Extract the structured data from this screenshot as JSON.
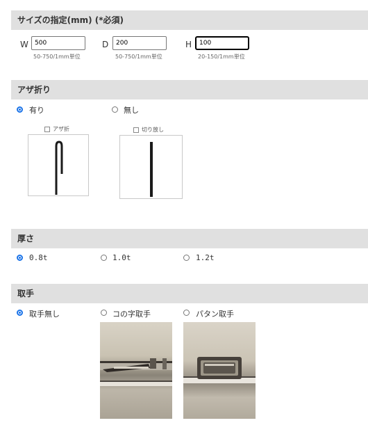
{
  "size_section": {
    "title": "サイズの指定(mm) (*必須)",
    "width": {
      "label": "W",
      "value": "500",
      "hint": "50-750/1mm単位"
    },
    "depth": {
      "label": "D",
      "value": "200",
      "hint": "50-750/1mm単位"
    },
    "height": {
      "label": "H",
      "value": "100",
      "hint": "20-150/1mm単位"
    }
  },
  "hem_section": {
    "title": "アザ折り",
    "options": [
      {
        "label": "有り",
        "checked": true
      },
      {
        "label": "無し",
        "checked": false
      }
    ],
    "diagrams": [
      {
        "caption": "アザ折"
      },
      {
        "caption": "切り放し"
      }
    ]
  },
  "thickness_section": {
    "title": "厚さ",
    "options": [
      {
        "label": "0.8t",
        "checked": true
      },
      {
        "label": "1.0t",
        "checked": false
      },
      {
        "label": "1.2t",
        "checked": false
      }
    ]
  },
  "handle_section": {
    "title": "取手",
    "options": [
      {
        "label": "取手無し",
        "checked": true
      },
      {
        "label": "コの字取手",
        "checked": false
      },
      {
        "label": "パタン取手",
        "checked": false
      }
    ]
  },
  "colors": {
    "header_bg": "#e0e0e0",
    "radio_accent": "#1a73e8"
  }
}
